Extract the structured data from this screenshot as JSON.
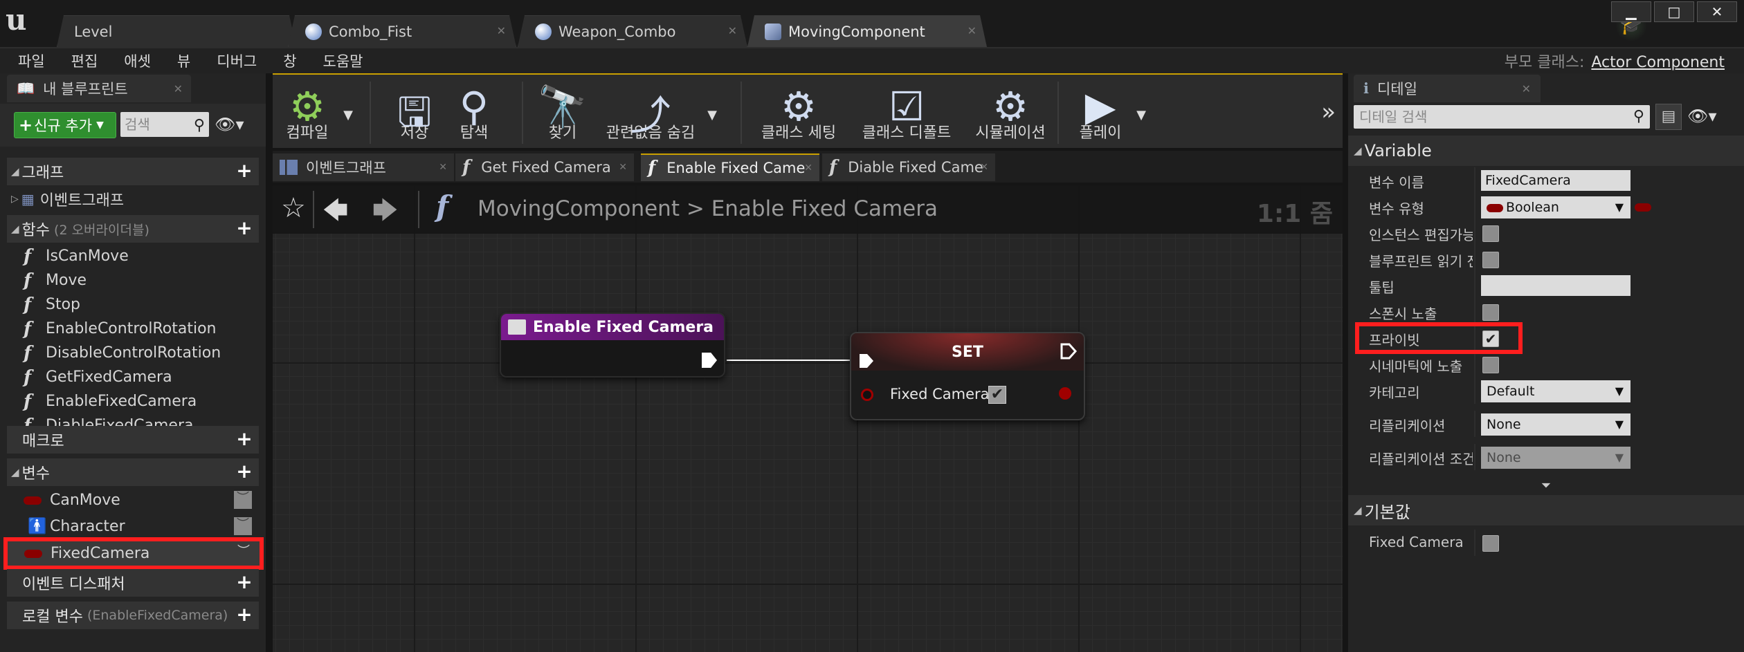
{
  "window": {
    "tabs": [
      {
        "label": "Level",
        "icon": "none"
      },
      {
        "label": "Combo_Fist",
        "icon": "blueprint-sphere-icon"
      },
      {
        "label": "Weapon_Combo",
        "icon": "blueprint-sphere-icon"
      },
      {
        "label": "MovingComponent",
        "icon": "component-icon"
      }
    ],
    "active_tab": "MovingComponent",
    "controls": {
      "minimize": "▁",
      "maximize": "□",
      "close": "✕"
    }
  },
  "menu": {
    "items": [
      "파일",
      "편집",
      "애셋",
      "뷰",
      "디버그",
      "창",
      "도움말"
    ],
    "parent_class_label": "부모 클래스:",
    "parent_class_value": "Actor Component"
  },
  "my_blueprint": {
    "tab_label": "내 블루프린트",
    "add_new_label": "신규 추가",
    "search_placeholder": "검색",
    "sections": {
      "graph": {
        "label": "그래프"
      },
      "event_graph": {
        "label": "이벤트그래프"
      },
      "functions": {
        "label": "함수",
        "sub": "(2 오버라이더블)"
      },
      "macros": {
        "label": "매크로"
      },
      "variables": {
        "label": "변수"
      },
      "event_dispatchers": {
        "label": "이벤트 디스패처"
      },
      "local_vars": {
        "label": "로컬 변수",
        "sub": "(EnableFixedCamera)"
      }
    },
    "functions": [
      "IsCanMove",
      "Move",
      "Stop",
      "EnableControlRotation",
      "DisableControlRotation",
      "GetFixedCamera",
      "EnableFixedCamera",
      "DiableFixedCamera"
    ],
    "variables": [
      {
        "name": "CanMove",
        "type": "boolean"
      },
      {
        "name": "Character",
        "type": "object"
      },
      {
        "name": "FixedCamera",
        "type": "boolean",
        "selected": true
      }
    ]
  },
  "toolbar": {
    "compile": "컴파일",
    "save": "저장",
    "browse": "탐색",
    "find": "찾기",
    "hide_unrelated": "관련없음 숨김",
    "class_settings": "클래스 세팅",
    "class_defaults": "클래스 디폴트",
    "simulation": "시뮬레이션",
    "play": "플레이"
  },
  "graph_tabs": [
    {
      "label": "이벤트그래프",
      "icon": "event-graph-icon"
    },
    {
      "label": "Get Fixed Camera",
      "icon": "function-icon"
    },
    {
      "label": "Enable Fixed Came",
      "icon": "function-icon",
      "active": true
    },
    {
      "label": "Diable Fixed Came",
      "icon": "function-icon"
    }
  ],
  "graph": {
    "breadcrumb_root": "MovingComponent",
    "breadcrumb_sep": ">",
    "breadcrumb_current": "Enable Fixed Camera",
    "zoom": "1:1 줌",
    "nodes": {
      "entry": {
        "title": "Enable Fixed Camera",
        "color": "#7a1b8e"
      },
      "set": {
        "title": "SET",
        "pin_label": "Fixed Camera",
        "pin_value": true,
        "color": "#8a2a2a"
      }
    }
  },
  "details": {
    "tab_label": "디테일",
    "search_placeholder": "디테일 검색",
    "category_variable": "Variable",
    "category_default": "기본값",
    "props": {
      "var_name": {
        "label": "변수 이름",
        "value": "FixedCamera"
      },
      "var_type": {
        "label": "변수 유형",
        "value": "Boolean"
      },
      "instance_editable": {
        "label": "인스턴스 편집가능",
        "checked": false
      },
      "bp_readonly": {
        "label": "블루프린트 읽기 전",
        "checked": false
      },
      "tooltip": {
        "label": "툴팁",
        "value": ""
      },
      "expose_spawn": {
        "label": "스폰시 노출",
        "checked": false
      },
      "private": {
        "label": "프라이빗",
        "checked": true
      },
      "expose_cine": {
        "label": "시네마틱에 노출",
        "checked": false
      },
      "category": {
        "label": "카테고리",
        "value": "Default"
      },
      "replication": {
        "label": "리플리케이션",
        "value": "None"
      },
      "rep_condition": {
        "label": "리플리케이션 조건",
        "value": "None"
      },
      "default_fixed": {
        "label": "Fixed Camera",
        "checked": false
      }
    }
  },
  "colors": {
    "accent_highlight": "#ff1e1e",
    "bool_pin": "#8a0000",
    "add_button": "#2f8f2f",
    "toolbar_accent": "#caa000"
  }
}
